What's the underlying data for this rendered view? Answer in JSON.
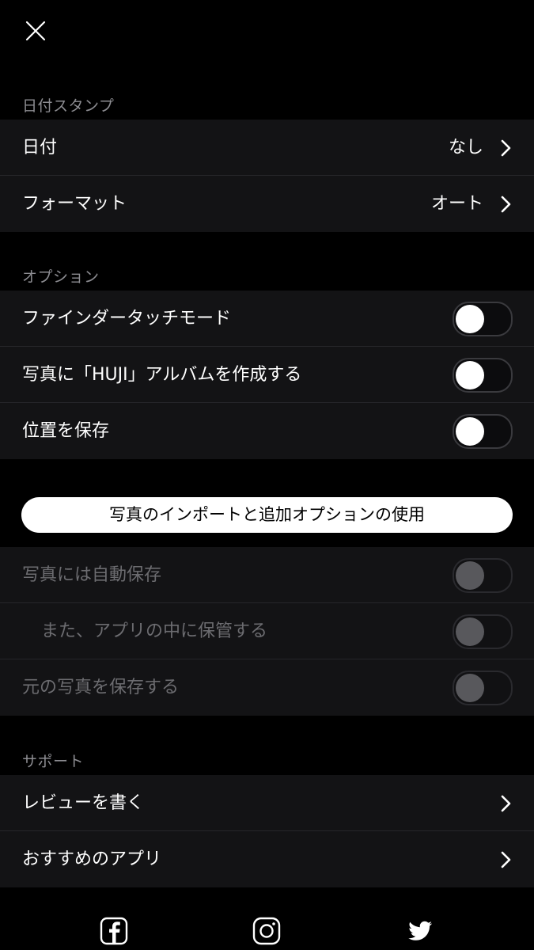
{
  "header": {
    "close_icon": "close-icon"
  },
  "date_stamp": {
    "section_title": "日付スタンプ",
    "rows": [
      {
        "label": "日付",
        "value": "なし"
      },
      {
        "label": "フォーマット",
        "value": "オート"
      }
    ]
  },
  "options": {
    "section_title": "オプション",
    "rows": [
      {
        "label": "ファインダータッチモード",
        "on": false
      },
      {
        "label": "写真に「HUJI」アルバムを作成する",
        "on": false
      },
      {
        "label": "位置を保存",
        "on": false
      }
    ]
  },
  "import": {
    "button_label": "写真のインポートと追加オプションの使用",
    "rows": [
      {
        "label": "写真には自動保存",
        "on": false,
        "enabled": false
      },
      {
        "label": "また、アプリの中に保管する",
        "on": false,
        "enabled": false
      },
      {
        "label": "元の写真を保存する",
        "on": false,
        "enabled": false
      }
    ]
  },
  "support": {
    "section_title": "サポート",
    "rows": [
      {
        "label": "レビューを書く"
      },
      {
        "label": "おすすめのアプリ"
      }
    ]
  },
  "social": [
    "facebook-icon",
    "instagram-icon",
    "twitter-icon"
  ],
  "colors": {
    "background": "#000000",
    "row_background": "#131315",
    "section_header": "#8d8d92",
    "disabled_text": "#6c6c70"
  }
}
